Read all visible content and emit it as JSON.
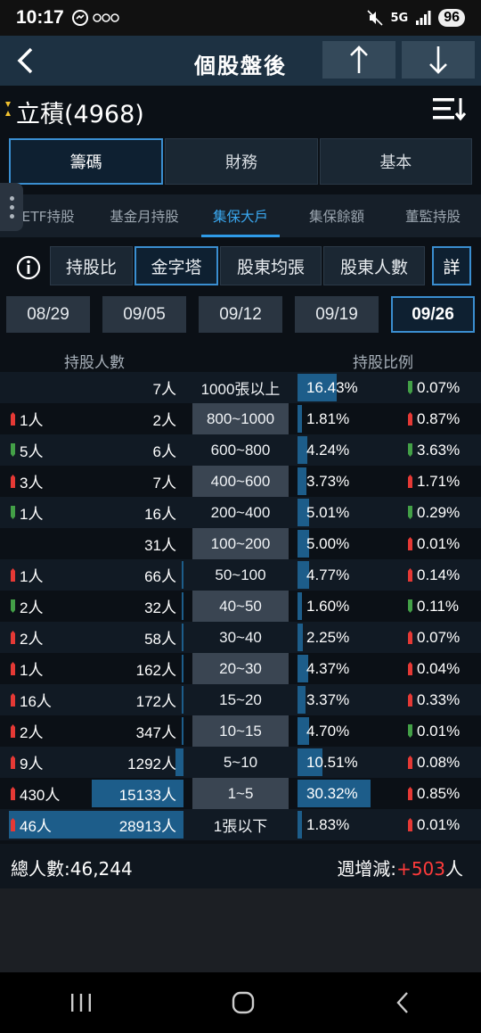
{
  "status": {
    "time": "10:17",
    "network": "5G",
    "battery": "96"
  },
  "header": {
    "title": "個股盤後"
  },
  "stock": {
    "name": "立積(4968)"
  },
  "main_tabs": [
    {
      "label": "籌碼",
      "active": true
    },
    {
      "label": "財務",
      "active": false
    },
    {
      "label": "基本",
      "active": false
    }
  ],
  "sub_tabs": [
    {
      "label": "ETF持股",
      "active": false
    },
    {
      "label": "基金月持股",
      "active": false
    },
    {
      "label": "集保大戶",
      "active": true
    },
    {
      "label": "集保餘額",
      "active": false
    },
    {
      "label": "董監持股",
      "active": false
    }
  ],
  "filters": [
    {
      "label": "持股比",
      "active": false
    },
    {
      "label": "金字塔",
      "active": true
    },
    {
      "label": "股東均張",
      "active": false
    },
    {
      "label": "股東人數",
      "active": false
    }
  ],
  "detail_label": "詳",
  "dates": [
    {
      "label": "08/29",
      "active": false
    },
    {
      "label": "09/05",
      "active": false
    },
    {
      "label": "09/12",
      "active": false
    },
    {
      "label": "09/19",
      "active": false
    },
    {
      "label": "09/26",
      "active": true
    }
  ],
  "table": {
    "left_header": "持股人數",
    "right_header": "持股比例",
    "rows": [
      {
        "chg": "",
        "chg_dir": "",
        "holders": "7人",
        "holders_bar": 0,
        "range": "1000張以上",
        "pct": "16.43%",
        "pct_value": 16.43,
        "wchg": "0.07%",
        "wchg_dir": "dn"
      },
      {
        "chg": "1人",
        "chg_dir": "up",
        "holders": "2人",
        "holders_bar": 0,
        "range": "800~1000",
        "pct": "1.81%",
        "pct_value": 1.81,
        "wchg": "0.87%",
        "wchg_dir": "up"
      },
      {
        "chg": "5人",
        "chg_dir": "dn",
        "holders": "6人",
        "holders_bar": 0,
        "range": "600~800",
        "pct": "4.24%",
        "pct_value": 4.24,
        "wchg": "3.63%",
        "wchg_dir": "dn"
      },
      {
        "chg": "3人",
        "chg_dir": "up",
        "holders": "7人",
        "holders_bar": 0,
        "range": "400~600",
        "pct": "3.73%",
        "pct_value": 3.73,
        "wchg": "1.71%",
        "wchg_dir": "up"
      },
      {
        "chg": "1人",
        "chg_dir": "dn",
        "holders": "16人",
        "holders_bar": 0,
        "range": "200~400",
        "pct": "5.01%",
        "pct_value": 5.01,
        "wchg": "0.29%",
        "wchg_dir": "dn"
      },
      {
        "chg": "",
        "chg_dir": "",
        "holders": "31人",
        "holders_bar": 0,
        "range": "100~200",
        "pct": "5.00%",
        "pct_value": 5.0,
        "wchg": "0.01%",
        "wchg_dir": "up"
      },
      {
        "chg": "1人",
        "chg_dir": "up",
        "holders": "66人",
        "holders_bar": 0.2,
        "range": "50~100",
        "pct": "4.77%",
        "pct_value": 4.77,
        "wchg": "0.14%",
        "wchg_dir": "up"
      },
      {
        "chg": "2人",
        "chg_dir": "dn",
        "holders": "32人",
        "holders_bar": 0.1,
        "range": "40~50",
        "pct": "1.60%",
        "pct_value": 1.6,
        "wchg": "0.11%",
        "wchg_dir": "dn"
      },
      {
        "chg": "2人",
        "chg_dir": "up",
        "holders": "58人",
        "holders_bar": 0.2,
        "range": "30~40",
        "pct": "2.25%",
        "pct_value": 2.25,
        "wchg": "0.07%",
        "wchg_dir": "up"
      },
      {
        "chg": "1人",
        "chg_dir": "up",
        "holders": "162人",
        "holders_bar": 0.56,
        "range": "20~30",
        "pct": "4.37%",
        "pct_value": 4.37,
        "wchg": "0.04%",
        "wchg_dir": "up"
      },
      {
        "chg": "16人",
        "chg_dir": "up",
        "holders": "172人",
        "holders_bar": 0.59,
        "range": "15~20",
        "pct": "3.37%",
        "pct_value": 3.37,
        "wchg": "0.33%",
        "wchg_dir": "up"
      },
      {
        "chg": "2人",
        "chg_dir": "up",
        "holders": "347人",
        "holders_bar": 1.2,
        "range": "10~15",
        "pct": "4.70%",
        "pct_value": 4.7,
        "wchg": "0.01%",
        "wchg_dir": "dn"
      },
      {
        "chg": "9人",
        "chg_dir": "up",
        "holders": "1292人",
        "holders_bar": 4.47,
        "range": "5~10",
        "pct": "10.51%",
        "pct_value": 10.51,
        "wchg": "0.08%",
        "wchg_dir": "up"
      },
      {
        "chg": "430人",
        "chg_dir": "up",
        "holders": "15133人",
        "holders_bar": 52.3,
        "range": "1~5",
        "pct": "30.32%",
        "pct_value": 30.32,
        "wchg": "0.85%",
        "wchg_dir": "up"
      },
      {
        "chg": "46人",
        "chg_dir": "up",
        "holders": "28913人",
        "holders_bar": 100,
        "range": "1張以下",
        "pct": "1.83%",
        "pct_value": 1.83,
        "wchg": "0.01%",
        "wchg_dir": "up"
      }
    ]
  },
  "footer": {
    "total_label": "總人數:",
    "total_value": "46,244",
    "weekly_label": "週增減:",
    "weekly_value": "+503",
    "weekly_unit": "人"
  },
  "colors": {
    "up": "#e53935",
    "down": "#43a047",
    "accent": "#3a8ed0",
    "bar": "#1d5d8a"
  }
}
